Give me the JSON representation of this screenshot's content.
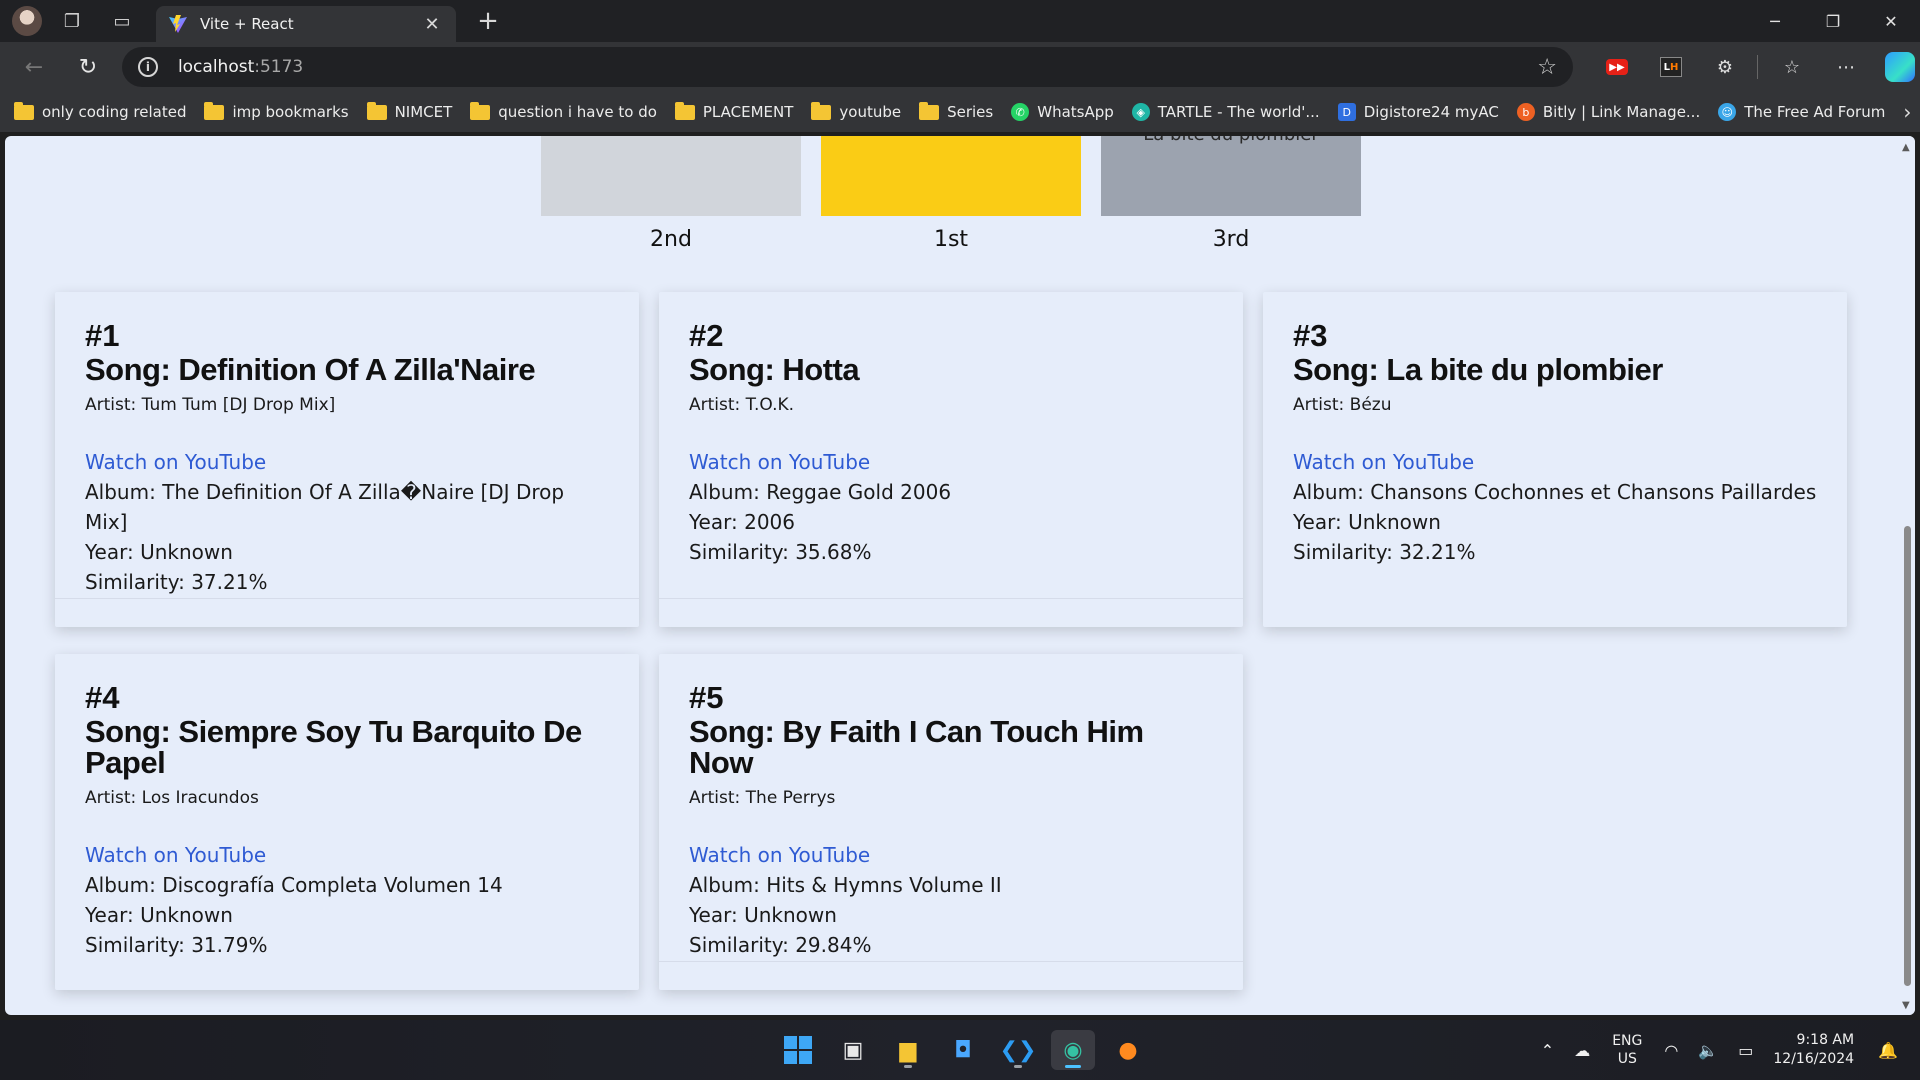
{
  "browser": {
    "tab_title": "Vite + React",
    "url_host": "localhost",
    "url_port": ":5173",
    "bookmarks": [
      {
        "label": "only coding  related",
        "type": "folder"
      },
      {
        "label": "imp bookmarks",
        "type": "folder"
      },
      {
        "label": "NIMCET",
        "type": "folder"
      },
      {
        "label": "question i have to do",
        "type": "folder"
      },
      {
        "label": "PLACEMENT",
        "type": "folder"
      },
      {
        "label": "youtube",
        "type": "folder"
      },
      {
        "label": "Series",
        "type": "folder"
      },
      {
        "label": "WhatsApp",
        "type": "site",
        "icon": "whatsapp-icon",
        "color": "#25d366"
      },
      {
        "label": "TARTLE - The world'...",
        "type": "site",
        "icon": "tartle-icon",
        "color": "#1fb6a6"
      },
      {
        "label": "Digistore24 myAC",
        "type": "site",
        "icon": "digistore-icon",
        "color": "#2f6fe0"
      },
      {
        "label": "Bitly | Link Manage...",
        "type": "site",
        "icon": "bitly-icon",
        "color": "#ee6123"
      },
      {
        "label": "The Free Ad Forum",
        "type": "site",
        "icon": "forum-icon",
        "color": "#3aa6e8"
      }
    ]
  },
  "podium": {
    "top_song_partial": "La bite du plombier",
    "labels": {
      "second": "2nd",
      "first": "1st",
      "third": "3rd"
    },
    "colors": {
      "first": "#facc15",
      "second": "#d1d5db",
      "third": "#9ca3af"
    }
  },
  "results": [
    {
      "rank": "#1",
      "song": "Song: Definition Of A Zilla'Naire",
      "artist": "Artist: Tum Tum [DJ Drop Mix]",
      "link": "Watch on YouTube",
      "album": "Album: The Definition Of A Zilla�Naire [DJ Drop Mix]",
      "year": "Year: Unknown",
      "similarity": "Similarity: 37.21%"
    },
    {
      "rank": "#2",
      "song": "Song: Hotta",
      "artist": "Artist: T.O.K.",
      "link": "Watch on YouTube",
      "album": "Album: Reggae Gold 2006",
      "year": "Year: 2006",
      "similarity": "Similarity: 35.68%"
    },
    {
      "rank": "#3",
      "song": "Song: La bite du plombier",
      "artist": "Artist: Bézu",
      "link": "Watch on YouTube",
      "album": "Album: Chansons Cochonnes et Chansons Paillardes",
      "year": "Year: Unknown",
      "similarity": "Similarity: 32.21%"
    },
    {
      "rank": "#4",
      "song": "Song: Siempre Soy Tu Barquito De Papel",
      "artist": "Artist: Los Iracundos",
      "link": "Watch on YouTube",
      "album": "Album: Discografía Completa Volumen 14",
      "year": "Year: Unknown",
      "similarity": "Similarity: 31.79%"
    },
    {
      "rank": "#5",
      "song": "Song: By Faith I Can Touch Him Now",
      "artist": "Artist: The Perrys",
      "link": "Watch on YouTube",
      "album": "Album: Hits & Hymns Volume II",
      "year": "Year: Unknown",
      "similarity": "Similarity: 29.84%"
    }
  ],
  "colors": {
    "link": "#2f5bd3",
    "page_bg": "#e6edfa"
  },
  "taskbar": {
    "lang_top": "ENG",
    "lang_bottom": "US",
    "time": "9:18 AM",
    "date": "12/16/2024"
  }
}
